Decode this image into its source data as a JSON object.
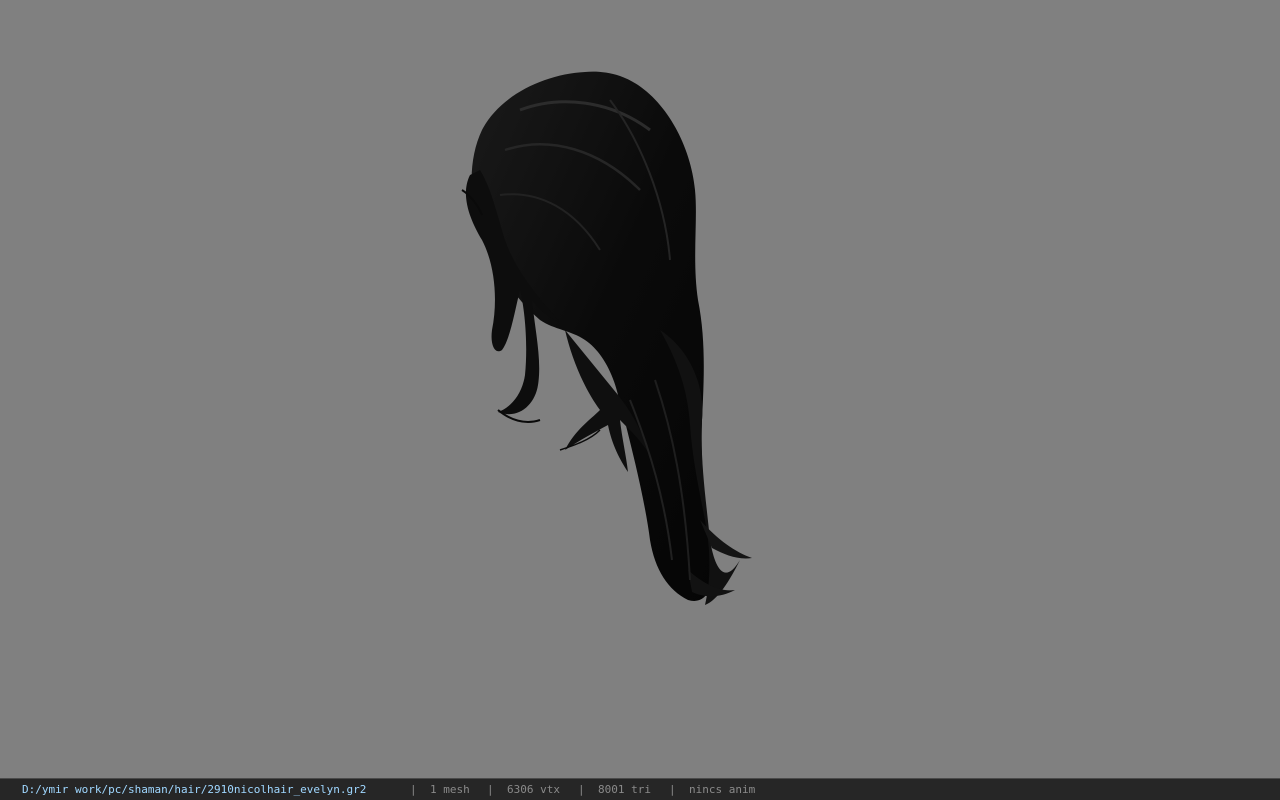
{
  "viewport": {
    "background_color": "#808080",
    "model_name": "hair mesh",
    "model_color": "#0b0b0b"
  },
  "statusbar": {
    "file_path": "D:/ymir work/pc/shaman/hair/2910nicolhair_evelyn.gr2",
    "separator": "|",
    "mesh_count": "1 mesh",
    "vertex_count": "6306 vtx",
    "triangle_count": "8001 tri",
    "anim_status": "nincs anim",
    "path_color": "#9fd7ff",
    "text_color": "#8a8a8a"
  }
}
